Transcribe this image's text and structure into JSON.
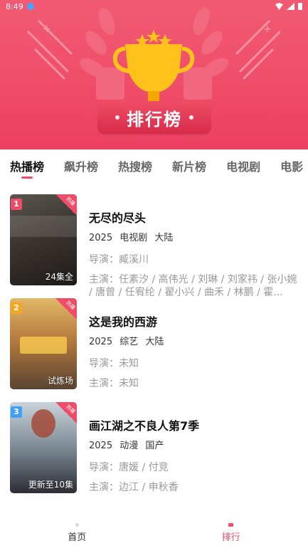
{
  "status": {
    "time": "8:49"
  },
  "banner": {
    "title": "排行榜"
  },
  "tabs": [
    {
      "label": "热播榜",
      "active": true
    },
    {
      "label": "飙升榜",
      "active": false
    },
    {
      "label": "热搜榜",
      "active": false
    },
    {
      "label": "新片榜",
      "active": false
    },
    {
      "label": "电视剧",
      "active": false
    },
    {
      "label": "电影",
      "active": false
    }
  ],
  "items": [
    {
      "rank": "1",
      "rank_color": "#ef4c68",
      "title": "无尽的尽头",
      "year": "2025",
      "category": "电视剧",
      "region": "大陆",
      "director": "导演：臧溪川",
      "cast": "主演：任素汐 / 高伟光 / 刘琳 / 刘家祎 / 张小婉 / 唐曾 / 任宥纶 / 翟小兴 / 曲禾 / 林鹏 / 霍...",
      "episode_label": "24集全",
      "hot_tag": "热播",
      "poster_colors": [
        "#3b3a3a",
        "#7c6f66",
        "#2a2523"
      ]
    },
    {
      "rank": "2",
      "rank_color": "#f5a623",
      "title": "这是我的西游",
      "year": "2025",
      "category": "综艺",
      "region": "大陆",
      "director": "导演：未知",
      "cast": "主演：未知",
      "episode_label": "试炼场",
      "hot_tag": "热播",
      "poster_colors": [
        "#d8a24c",
        "#9c6a3a",
        "#4d3b2f"
      ]
    },
    {
      "rank": "3",
      "rank_color": "#3fa1f5",
      "title": "画江湖之不良人第7季",
      "year": "2025",
      "category": "动漫",
      "region": "国产",
      "director": "导演：唐媛 / 付竞",
      "cast": "主演：边江 / 申秋香",
      "episode_label": "更新至10集",
      "hot_tag": "热播",
      "poster_colors": [
        "#b7c3cd",
        "#6f7c87",
        "#2d2e33"
      ]
    }
  ],
  "bottom_nav": [
    {
      "label": "首页",
      "active": false
    },
    {
      "label": "排行",
      "active": true
    }
  ]
}
